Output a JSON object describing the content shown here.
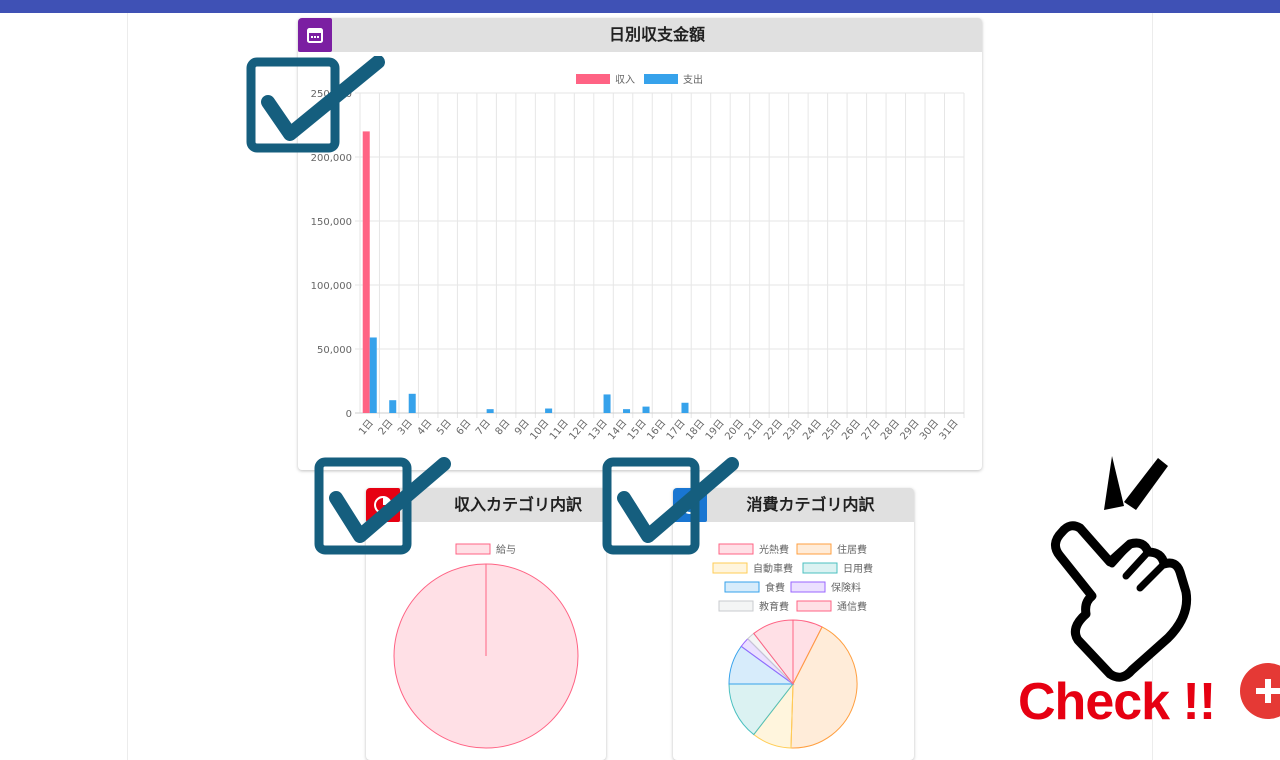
{
  "app": {
    "accent": "#3f51b5"
  },
  "daily_card": {
    "title": "日別収支金額",
    "icon": "calendar-icon",
    "icon_color": "#7b1fa2"
  },
  "income_card": {
    "title": "収入カテゴリ内訳",
    "icon": "pie-chart-icon",
    "icon_color": "#e60012"
  },
  "expense_card": {
    "title": "消費カテゴリ内訳",
    "icon": "pie-chart-icon",
    "icon_color": "#1976d2"
  },
  "overlay": {
    "check_text": "Check !!",
    "plus_icon": "plus-icon"
  },
  "chart_data": [
    {
      "type": "bar",
      "title": "",
      "categories": [
        "1日",
        "2日",
        "3日",
        "4日",
        "5日",
        "6日",
        "7日",
        "8日",
        "9日",
        "10日",
        "11日",
        "12日",
        "13日",
        "14日",
        "15日",
        "16日",
        "17日",
        "18日",
        "19日",
        "20日",
        "21日",
        "22日",
        "23日",
        "24日",
        "25日",
        "26日",
        "27日",
        "28日",
        "29日",
        "30日",
        "31日"
      ],
      "series": [
        {
          "name": "収入",
          "color": "#ff6384",
          "values": [
            220000,
            0,
            0,
            0,
            0,
            0,
            0,
            0,
            0,
            0,
            0,
            0,
            0,
            0,
            0,
            0,
            0,
            0,
            0,
            0,
            0,
            0,
            0,
            0,
            0,
            0,
            0,
            0,
            0,
            0,
            0
          ]
        },
        {
          "name": "支出",
          "color": "#36a2eb",
          "values": [
            59000,
            10000,
            15000,
            0,
            0,
            0,
            3000,
            0,
            0,
            3500,
            0,
            0,
            14500,
            3000,
            5000,
            0,
            8000,
            0,
            0,
            0,
            0,
            0,
            0,
            0,
            0,
            0,
            0,
            0,
            0,
            0,
            0
          ]
        }
      ],
      "ylim": [
        0,
        250000
      ],
      "yticks": [
        "0",
        "50,000",
        "100,000",
        "150,000",
        "200,000",
        "250,000"
      ],
      "legend": "top",
      "grid": true
    },
    {
      "type": "pie",
      "title": "",
      "labels": [
        "給与"
      ],
      "values": [
        100
      ],
      "colors": [
        "#ff6384"
      ],
      "legend": "top"
    },
    {
      "type": "pie",
      "title": "",
      "labels": [
        "光熱費",
        "住居費",
        "自動車費",
        "日用費",
        "食費",
        "保険料",
        "教育費",
        "通信費"
      ],
      "values": [
        7.5,
        43,
        10,
        14.5,
        10,
        2.5,
        2,
        10.5
      ],
      "colors": [
        "#ff6384",
        "#ff9f40",
        "#ffcd56",
        "#4bc0c0",
        "#36a2eb",
        "#9966ff",
        "#c9cbcf",
        "#ff6384"
      ],
      "legend": "top"
    }
  ]
}
